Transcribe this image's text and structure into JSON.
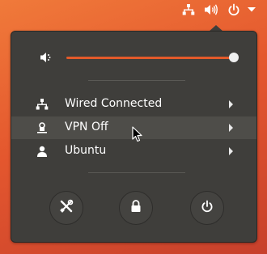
{
  "topbar": {
    "icons": [
      "network-wired-icon",
      "volume-icon",
      "power-icon",
      "chevron-down-icon"
    ]
  },
  "menu": {
    "volume": {
      "icon": "volume-icon",
      "level": 0.99
    },
    "items": [
      {
        "label": "Wired Connected",
        "icon": "network-wired-icon"
      },
      {
        "label": "VPN Off",
        "icon": "vpn-lock-icon"
      },
      {
        "label": "Ubuntu",
        "icon": "user-icon"
      }
    ],
    "actions": [
      "settings-icon",
      "lock-icon",
      "power-off-icon"
    ]
  },
  "colors": {
    "accent": "#e35a2a",
    "menu_bg": "#3f3e3b",
    "hover_bg": "#4e4d49"
  }
}
